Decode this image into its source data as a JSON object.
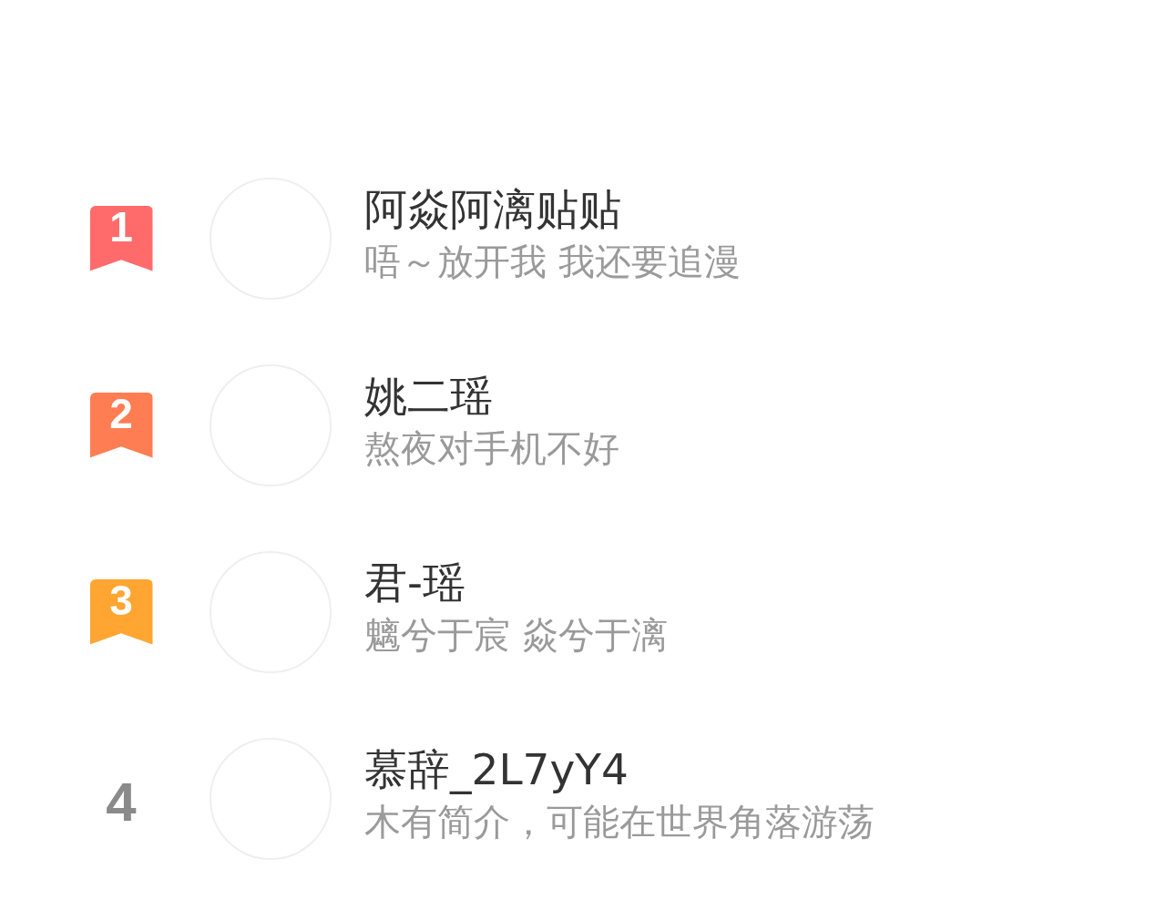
{
  "ranking": [
    {
      "rank": "1",
      "kind": "ribbon",
      "color": "#ff6b6b",
      "name": "阿焱阿漓贴贴",
      "bio": "唔～放开我 我还要追漫"
    },
    {
      "rank": "2",
      "kind": "ribbon",
      "color": "#ff7d52",
      "name": "姚二瑶",
      "bio": "熬夜对手机不好"
    },
    {
      "rank": "3",
      "kind": "ribbon",
      "color": "#ffa531",
      "name": "君-瑶",
      "bio": "魑兮于宸 焱兮于漓"
    },
    {
      "rank": "4",
      "kind": "plain",
      "name": "慕辞_2L7yY4",
      "bio": "木有简介，可能在世界角落游荡"
    }
  ]
}
